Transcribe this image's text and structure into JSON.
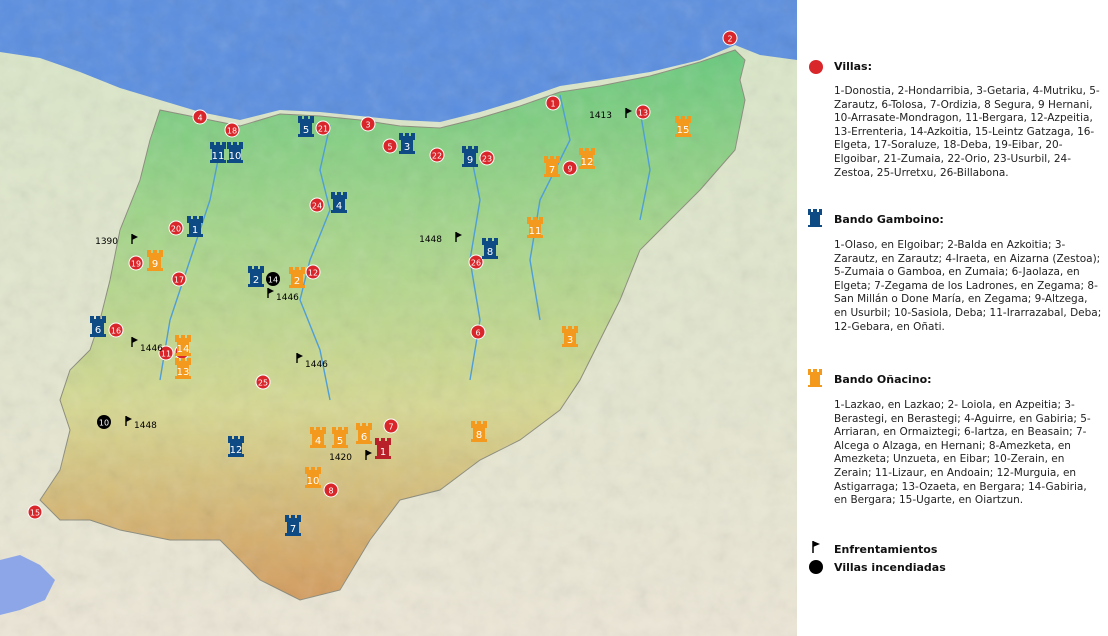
{
  "colors": {
    "sea": "#5a8ee0",
    "lowland": "#7fd08a",
    "hill": "#c9d79a",
    "mountain": "#d9a86a",
    "river": "#4f9ed8",
    "villa": "#d9262b",
    "gamboino": "#0e4a84",
    "onacino": "#f39a1e",
    "burned": "#000000"
  },
  "legend": {
    "villas": {
      "title": "Villas:",
      "text": "1-Donostia, 2-Hondarribia, 3-Getaria, 4-Mutriku, 5-Zarautz, 6-Tolosa, 7-Ordizia, 8 Segura, 9 Hernani, 10-Arrasate-Mondragon, 11-Bergara, 12-Azpeitia, 13-Errenteria, 14-Azkoitia, 15-Leintz Gatzaga, 16-Elgeta, 17-Soraluze, 18-Deba, 19-Eibar, 20-Elgoibar, 21-Zumaia, 22-Orio, 23-Usurbil, 24-Zestoa, 25-Urretxu, 26-Billabona."
    },
    "gamboino": {
      "title": "Bando Gamboino:",
      "text": "1-Olaso, en Elgoibar; 2-Balda en Azkoitia; 3-Zarautz, en Zarautz; 4-Iraeta, en Aizarna (Zestoa); 5-Zumaia o Gamboa, en Zumaia; 6-Jaolaza, en Elgeta; 7-Zegama de los Ladrones, en Zegama; 8-San Millán o Done María, en Zegama; 9-Altzega, en Usurbil; 10-Sasiola, Deba; 11-Irarrazabal, Deba; 12-Gebara, en Oñati."
    },
    "onacino": {
      "title": "Bando Oñacino:",
      "text": "1-Lazkao, en Lazkao; 2- Loiola, en Azpeitia; 3-Berastegi, en Berastegi; 4-Aguirre, en Gabiria; 5-Arriaran, en Ormaiztegi; 6-Iartza, en Beasain; 7-Alcega o Alzaga, en Hernani; 8-Amezketa, en Amezketa; Unzueta, en Eibar; 10-Zerain, en Zerain; 11-Lizaur, en Andoain; 12-Murguia, en Astigarraga; 13-Ozaeta, en Bergara; 14-Gabiria, en Bergara; 15-Ugarte, en Oiartzun."
    },
    "enfrentamientos": "Enfrentamientos",
    "incendiadas": "Villas incendiadas"
  },
  "villas": [
    "1",
    "2",
    "3",
    "4",
    "5",
    "6",
    "7",
    "8",
    "9",
    "10",
    "11",
    "12",
    "13",
    "14",
    "15",
    "16",
    "17",
    "18",
    "19",
    "20",
    "21",
    "22",
    "23",
    "24",
    "25",
    "26"
  ],
  "gamboino_towers": [
    "1",
    "2",
    "3",
    "4",
    "5",
    "6",
    "7",
    "8",
    "9",
    "10",
    "11",
    "12"
  ],
  "onacino_towers": [
    "1",
    "2",
    "3",
    "4",
    "5",
    "6",
    "7",
    "8",
    "9",
    "10",
    "11",
    "12",
    "13",
    "14",
    "15"
  ],
  "battles": [
    "1413",
    "1390",
    "1448",
    "1446",
    "1446",
    "1446",
    "1448",
    "1420"
  ],
  "burned_villas": [
    "14",
    "10"
  ]
}
